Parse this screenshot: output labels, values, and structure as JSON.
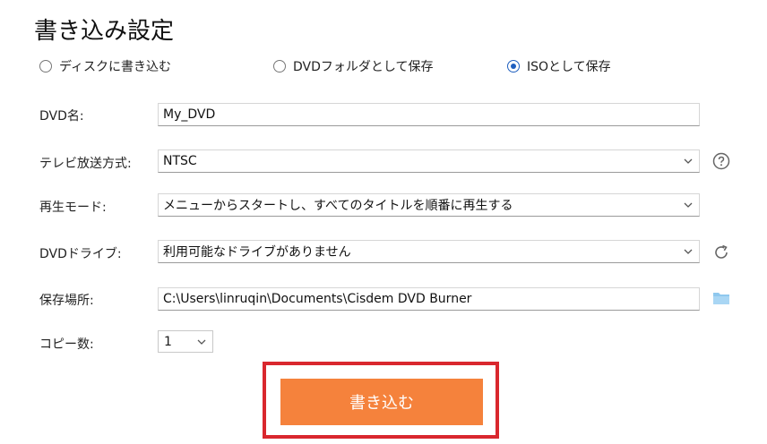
{
  "title": "書き込み設定",
  "output_options": [
    {
      "label": "ディスクに書き込む",
      "selected": false
    },
    {
      "label": "DVDフォルダとして保存",
      "selected": false
    },
    {
      "label": "ISOとして保存",
      "selected": true
    }
  ],
  "dvd_name": {
    "label": "DVD名:",
    "value": "My_DVD"
  },
  "tv_system": {
    "label": "テレビ放送方式:",
    "value": "NTSC",
    "help_icon": "question-circle-icon"
  },
  "play_mode": {
    "label": "再生モード:",
    "value": "メニューからスタートし、すべてのタイトルを順番に再生する"
  },
  "dvd_drive": {
    "label": "DVDドライブ:",
    "value": "利用可能なドライブがありません",
    "refresh_icon": "refresh-icon"
  },
  "save_location": {
    "label": "保存場所:",
    "value": "C:\\Users\\linruqin\\Documents\\Cisdem DVD Burner",
    "folder_icon": "folder-icon"
  },
  "copies": {
    "label": "コピー数:",
    "value": "1"
  },
  "burn_button": {
    "label": "書き込む"
  },
  "colors": {
    "accent": "#f5823c",
    "highlight": "#d9272e",
    "radio_selected": "#1f5fbf",
    "folder": "#8fc8ee"
  }
}
